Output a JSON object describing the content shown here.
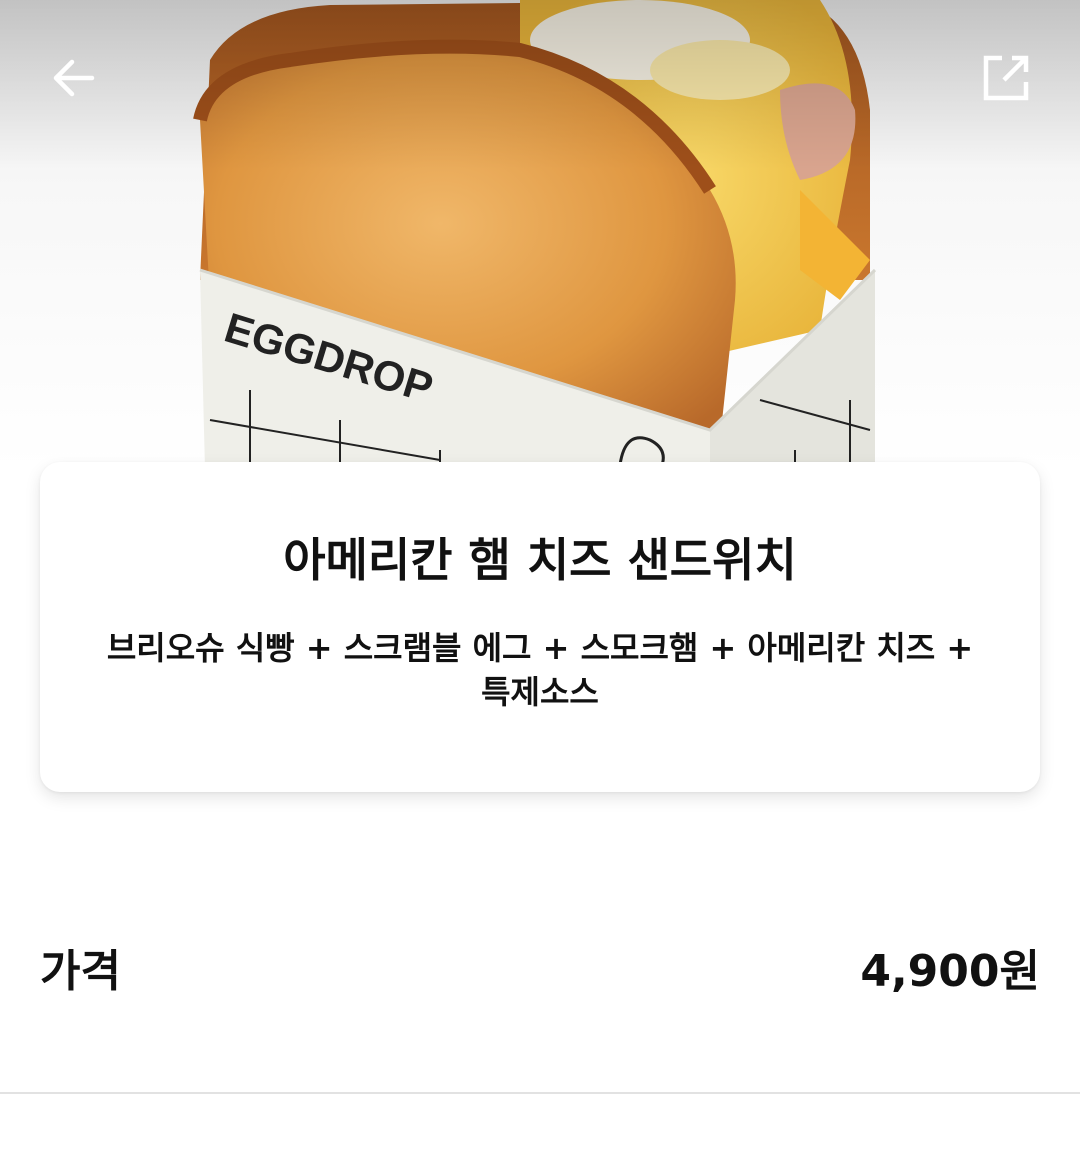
{
  "hero": {
    "box_brand_text": "EGGDROP"
  },
  "nav": {
    "back_icon": "arrow-left-icon",
    "share_icon": "external-share-icon"
  },
  "product": {
    "name": "아메리칸 햄 치즈 샌드위치",
    "description": "브리오슈 식빵 + 스크램블 에그 + 스모크햄 + 아메리칸 치즈 + 특제소스"
  },
  "price": {
    "label": "가격",
    "value": "4,900원"
  }
}
